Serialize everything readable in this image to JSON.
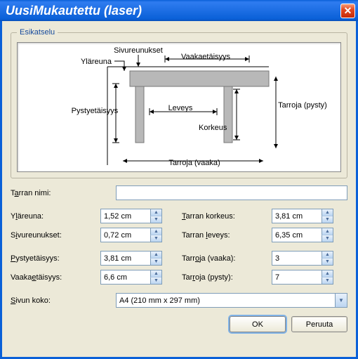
{
  "window": {
    "title": "UusiMukautettu (laser)"
  },
  "preview": {
    "legend": "Esikatselu",
    "labels": {
      "sivureunukset": "Sivureunukset",
      "ylareuna": "Yläreuna",
      "vaakaetaisyys": "Vaakaetäisyys",
      "pystyetaisyys": "Pystyetäisyys",
      "leveys": "Leveys",
      "korkeus": "Korkeus",
      "tarroja_pysty": "Tarroja (pysty)",
      "tarroja_vaaka": "Tarroja (vaaka)"
    }
  },
  "fields": {
    "tarran_nimi": {
      "label_pre": "T",
      "label_u": "a",
      "label_post": "rran nimi:",
      "value": ""
    },
    "ylareuna": {
      "label_pre": "Y",
      "label_u": "l",
      "label_post": "äreuna:",
      "value": "1,52 cm"
    },
    "sivureunukset": {
      "label_pre": "S",
      "label_u": "i",
      "label_post": "vureunukset:",
      "value": "0,72 cm"
    },
    "pystyetaisyys": {
      "label_pre": "",
      "label_u": "P",
      "label_post": "ystyetäisyys:",
      "value": "3,81 cm"
    },
    "vaakaetaisyys": {
      "label_pre": "Vaaka",
      "label_u": "e",
      "label_post": "täisyys:",
      "value": "6,6 cm"
    },
    "tarran_korkeus": {
      "label_pre": "",
      "label_u": "T",
      "label_post": "arran korkeus:",
      "value": "3,81 cm"
    },
    "tarran_leveys": {
      "label_pre": "Tarran ",
      "label_u": "l",
      "label_post": "eveys:",
      "value": "6,35 cm"
    },
    "tarroja_vaaka": {
      "label_pre": "Tarr",
      "label_u": "o",
      "label_post": "ja (vaaka):",
      "value": "3"
    },
    "tarroja_pysty": {
      "label_pre": "Tar",
      "label_u": "r",
      "label_post": "oja (pysty):",
      "value": "7"
    },
    "sivun_koko": {
      "label_pre": "",
      "label_u": "S",
      "label_post": "ivun koko:",
      "value": "A4 (210 mm x 297 mm)"
    }
  },
  "buttons": {
    "ok": "OK",
    "cancel": "Peruuta"
  }
}
